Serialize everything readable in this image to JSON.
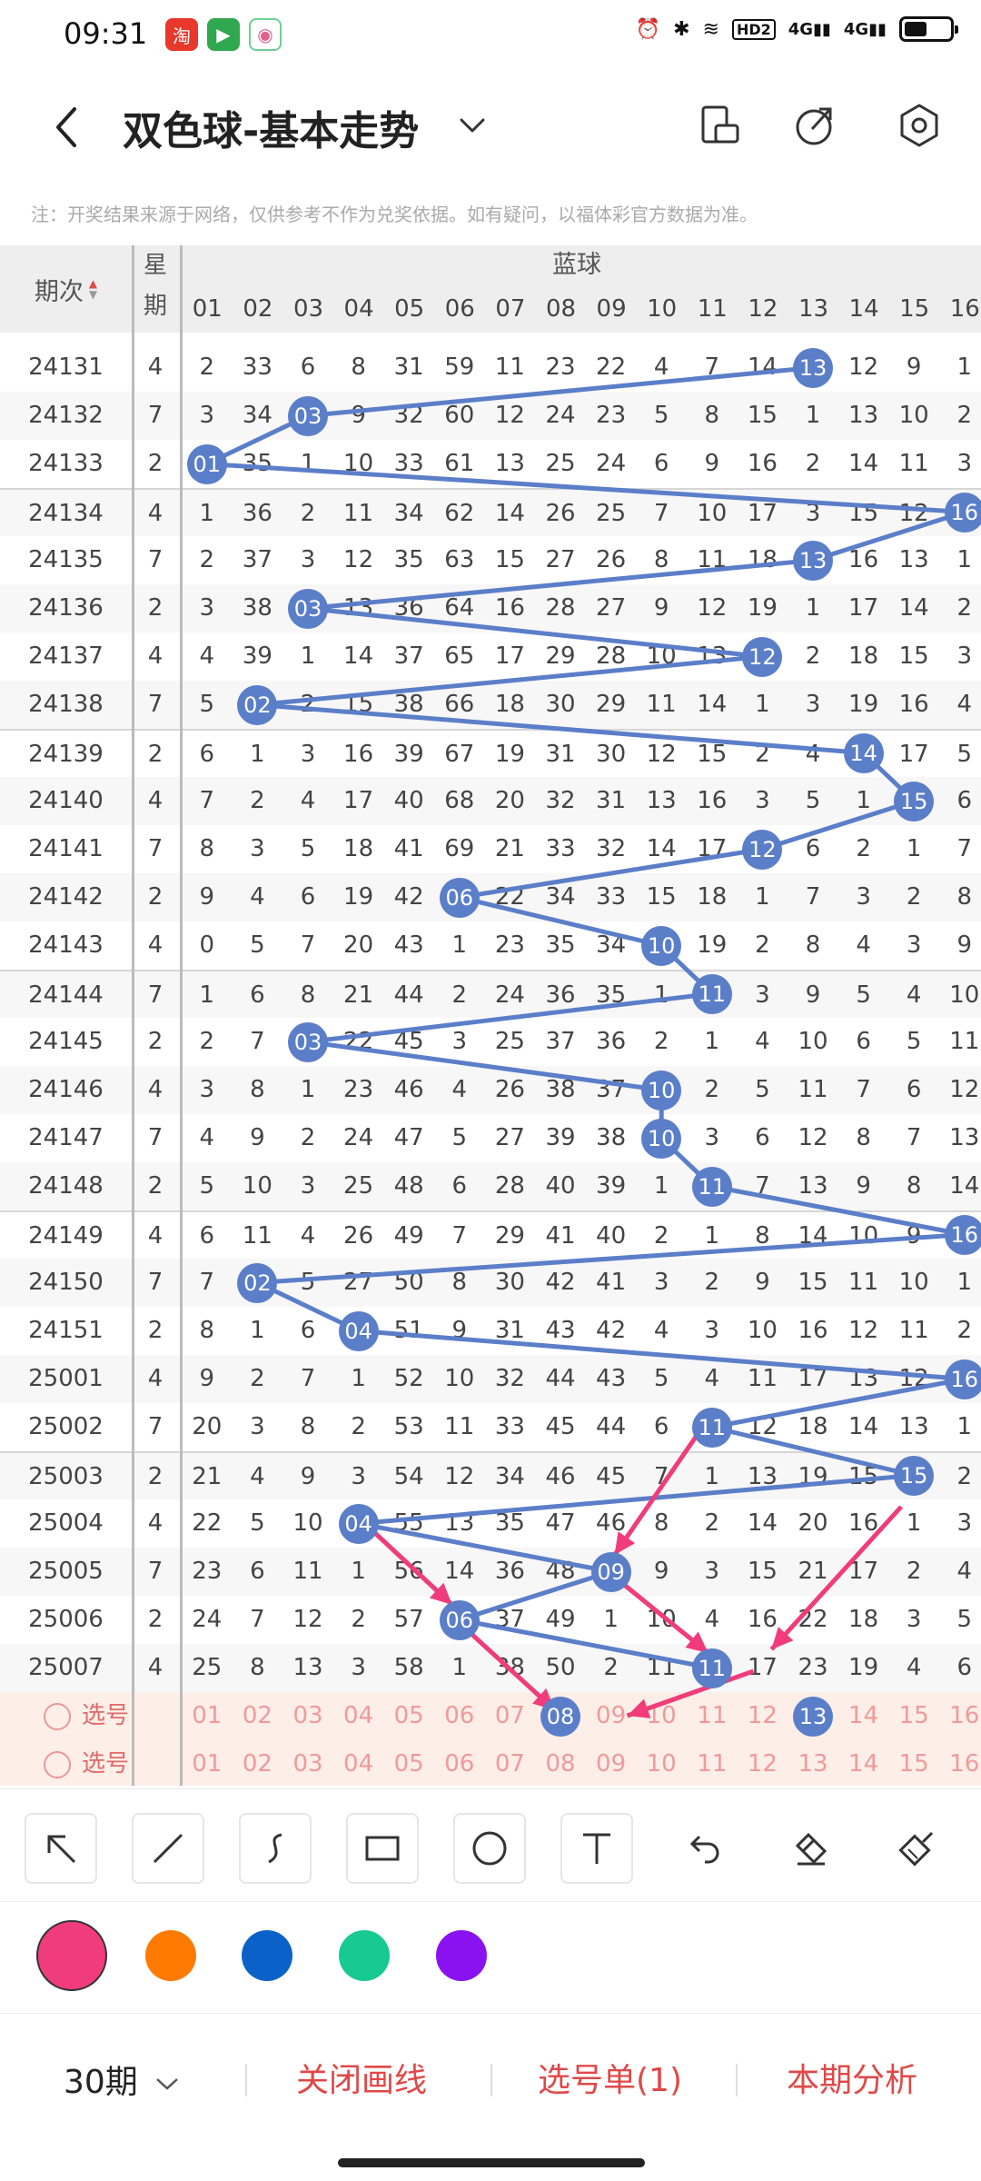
{
  "status_bar": {
    "time": "09:31",
    "network": "4G",
    "hd_label": "HD2"
  },
  "header": {
    "title": "双色球-基本走势"
  },
  "note": "注：开奖结果来源于网络，仅供参考不作为兑奖依据。如有疑问，以福体彩官方数据为准。",
  "table": {
    "col_period": "期次",
    "col_week_1": "星",
    "col_week_2": "期",
    "group_label": "蓝球",
    "columns": [
      "01",
      "02",
      "03",
      "04",
      "05",
      "06",
      "07",
      "08",
      "09",
      "10",
      "11",
      "12",
      "13",
      "14",
      "15",
      "16"
    ],
    "rows": [
      {
        "period": "24131",
        "week": "4",
        "ball": "13",
        "cells": [
          "2",
          "33",
          "6",
          "8",
          "31",
          "59",
          "11",
          "23",
          "22",
          "4",
          "7",
          "14",
          "13",
          "12",
          "9",
          "1"
        ]
      },
      {
        "period": "24132",
        "week": "7",
        "ball": "03",
        "cells": [
          "3",
          "34",
          "03",
          "9",
          "32",
          "60",
          "12",
          "24",
          "23",
          "5",
          "8",
          "15",
          "1",
          "13",
          "10",
          "2"
        ]
      },
      {
        "period": "24133",
        "week": "2",
        "ball": "01",
        "cells": [
          "01",
          "35",
          "1",
          "10",
          "33",
          "61",
          "13",
          "25",
          "24",
          "6",
          "9",
          "16",
          "2",
          "14",
          "11",
          "3"
        ]
      },
      {
        "period": "24134",
        "week": "4",
        "ball": "16",
        "cells": [
          "1",
          "36",
          "2",
          "11",
          "34",
          "62",
          "14",
          "26",
          "25",
          "7",
          "10",
          "17",
          "3",
          "15",
          "12",
          "16"
        ]
      },
      {
        "period": "24135",
        "week": "7",
        "ball": "13",
        "cells": [
          "2",
          "37",
          "3",
          "12",
          "35",
          "63",
          "15",
          "27",
          "26",
          "8",
          "11",
          "18",
          "13",
          "16",
          "13",
          "1"
        ]
      },
      {
        "period": "24136",
        "week": "2",
        "ball": "03",
        "cells": [
          "3",
          "38",
          "03",
          "13",
          "36",
          "64",
          "16",
          "28",
          "27",
          "9",
          "12",
          "19",
          "1",
          "17",
          "14",
          "2"
        ]
      },
      {
        "period": "24137",
        "week": "4",
        "ball": "12",
        "cells": [
          "4",
          "39",
          "1",
          "14",
          "37",
          "65",
          "17",
          "29",
          "28",
          "10",
          "13",
          "12",
          "2",
          "18",
          "15",
          "3"
        ]
      },
      {
        "period": "24138",
        "week": "7",
        "ball": "02",
        "cells": [
          "5",
          "02",
          "2",
          "15",
          "38",
          "66",
          "18",
          "30",
          "29",
          "11",
          "14",
          "1",
          "3",
          "19",
          "16",
          "4"
        ]
      },
      {
        "period": "24139",
        "week": "2",
        "ball": "14",
        "cells": [
          "6",
          "1",
          "3",
          "16",
          "39",
          "67",
          "19",
          "31",
          "30",
          "12",
          "15",
          "2",
          "4",
          "14",
          "17",
          "5"
        ]
      },
      {
        "period": "24140",
        "week": "4",
        "ball": "15",
        "cells": [
          "7",
          "2",
          "4",
          "17",
          "40",
          "68",
          "20",
          "32",
          "31",
          "13",
          "16",
          "3",
          "5",
          "1",
          "15",
          "6"
        ]
      },
      {
        "period": "24141",
        "week": "7",
        "ball": "12",
        "cells": [
          "8",
          "3",
          "5",
          "18",
          "41",
          "69",
          "21",
          "33",
          "32",
          "14",
          "17",
          "12",
          "6",
          "2",
          "1",
          "7"
        ]
      },
      {
        "period": "24142",
        "week": "2",
        "ball": "06",
        "cells": [
          "9",
          "4",
          "6",
          "19",
          "42",
          "06",
          "22",
          "34",
          "33",
          "15",
          "18",
          "1",
          "7",
          "3",
          "2",
          "8"
        ]
      },
      {
        "period": "24143",
        "week": "4",
        "ball": "10",
        "cells": [
          "0",
          "5",
          "7",
          "20",
          "43",
          "1",
          "23",
          "35",
          "34",
          "10",
          "19",
          "2",
          "8",
          "4",
          "3",
          "9"
        ]
      },
      {
        "period": "24144",
        "week": "7",
        "ball": "11",
        "cells": [
          "1",
          "6",
          "8",
          "21",
          "44",
          "2",
          "24",
          "36",
          "35",
          "1",
          "11",
          "3",
          "9",
          "5",
          "4",
          "10"
        ]
      },
      {
        "period": "24145",
        "week": "2",
        "ball": "03",
        "cells": [
          "2",
          "7",
          "03",
          "22",
          "45",
          "3",
          "25",
          "37",
          "36",
          "2",
          "1",
          "4",
          "10",
          "6",
          "5",
          "11"
        ]
      },
      {
        "period": "24146",
        "week": "4",
        "ball": "10",
        "cells": [
          "3",
          "8",
          "1",
          "23",
          "46",
          "4",
          "26",
          "38",
          "37",
          "10",
          "2",
          "5",
          "11",
          "7",
          "6",
          "12"
        ]
      },
      {
        "period": "24147",
        "week": "7",
        "ball": "10",
        "cells": [
          "4",
          "9",
          "2",
          "24",
          "47",
          "5",
          "27",
          "39",
          "38",
          "10",
          "3",
          "6",
          "12",
          "8",
          "7",
          "13"
        ]
      },
      {
        "period": "24148",
        "week": "2",
        "ball": "11",
        "cells": [
          "5",
          "10",
          "3",
          "25",
          "48",
          "6",
          "28",
          "40",
          "39",
          "1",
          "11",
          "7",
          "13",
          "9",
          "8",
          "14"
        ]
      },
      {
        "period": "24149",
        "week": "4",
        "ball": "16",
        "cells": [
          "6",
          "11",
          "4",
          "26",
          "49",
          "7",
          "29",
          "41",
          "40",
          "2",
          "1",
          "8",
          "14",
          "10",
          "9",
          "16"
        ]
      },
      {
        "period": "24150",
        "week": "7",
        "ball": "02",
        "cells": [
          "7",
          "02",
          "5",
          "27",
          "50",
          "8",
          "30",
          "42",
          "41",
          "3",
          "2",
          "9",
          "15",
          "11",
          "10",
          "1"
        ]
      },
      {
        "period": "24151",
        "week": "2",
        "ball": "04",
        "cells": [
          "8",
          "1",
          "6",
          "04",
          "51",
          "9",
          "31",
          "43",
          "42",
          "4",
          "3",
          "10",
          "16",
          "12",
          "11",
          "2"
        ]
      },
      {
        "period": "25001",
        "week": "4",
        "ball": "16",
        "cells": [
          "9",
          "2",
          "7",
          "1",
          "52",
          "10",
          "32",
          "44",
          "43",
          "5",
          "4",
          "11",
          "17",
          "13",
          "12",
          "16"
        ]
      },
      {
        "period": "25002",
        "week": "7",
        "ball": "11",
        "cells": [
          "20",
          "3",
          "8",
          "2",
          "53",
          "11",
          "33",
          "45",
          "44",
          "6",
          "11",
          "12",
          "18",
          "14",
          "13",
          "1"
        ]
      },
      {
        "period": "25003",
        "week": "2",
        "ball": "15",
        "cells": [
          "21",
          "4",
          "9",
          "3",
          "54",
          "12",
          "34",
          "46",
          "45",
          "7",
          "1",
          "13",
          "19",
          "15",
          "15",
          "2"
        ]
      },
      {
        "period": "25004",
        "week": "4",
        "ball": "04",
        "cells": [
          "22",
          "5",
          "10",
          "04",
          "55",
          "13",
          "35",
          "47",
          "46",
          "8",
          "2",
          "14",
          "20",
          "16",
          "1",
          "3"
        ]
      },
      {
        "period": "25005",
        "week": "7",
        "ball": "09",
        "cells": [
          "23",
          "6",
          "11",
          "1",
          "56",
          "14",
          "36",
          "48",
          "09",
          "9",
          "3",
          "15",
          "21",
          "17",
          "2",
          "4"
        ]
      },
      {
        "period": "25006",
        "week": "2",
        "ball": "06",
        "cells": [
          "24",
          "7",
          "12",
          "2",
          "57",
          "06",
          "37",
          "49",
          "1",
          "10",
          "4",
          "16",
          "22",
          "18",
          "3",
          "5"
        ]
      },
      {
        "period": "25007",
        "week": "4",
        "ball": "11",
        "cells": [
          "25",
          "8",
          "13",
          "3",
          "58",
          "1",
          "38",
          "50",
          "2",
          "11",
          "11",
          "17",
          "23",
          "19",
          "4",
          "6"
        ]
      }
    ],
    "pick_label": "选号",
    "pick_selected_ball": "13",
    "pick_marked_ball": "08"
  },
  "toolbar": {
    "tools": [
      "arrow-tool",
      "line-tool",
      "curve-tool",
      "rectangle-tool",
      "circle-tool",
      "text-tool",
      "undo-tool",
      "eraser-tool",
      "clear-tool"
    ],
    "colors": [
      "#f03c7a",
      "#ff7a00",
      "#0a62c8",
      "#18c990",
      "#8a12f0"
    ],
    "selected_color": "#f03c7a"
  },
  "bottom_bar": {
    "periods": "30期",
    "close_lines": "关闭画线",
    "pick_list": "选号单(1)",
    "analysis": "本期分析"
  }
}
